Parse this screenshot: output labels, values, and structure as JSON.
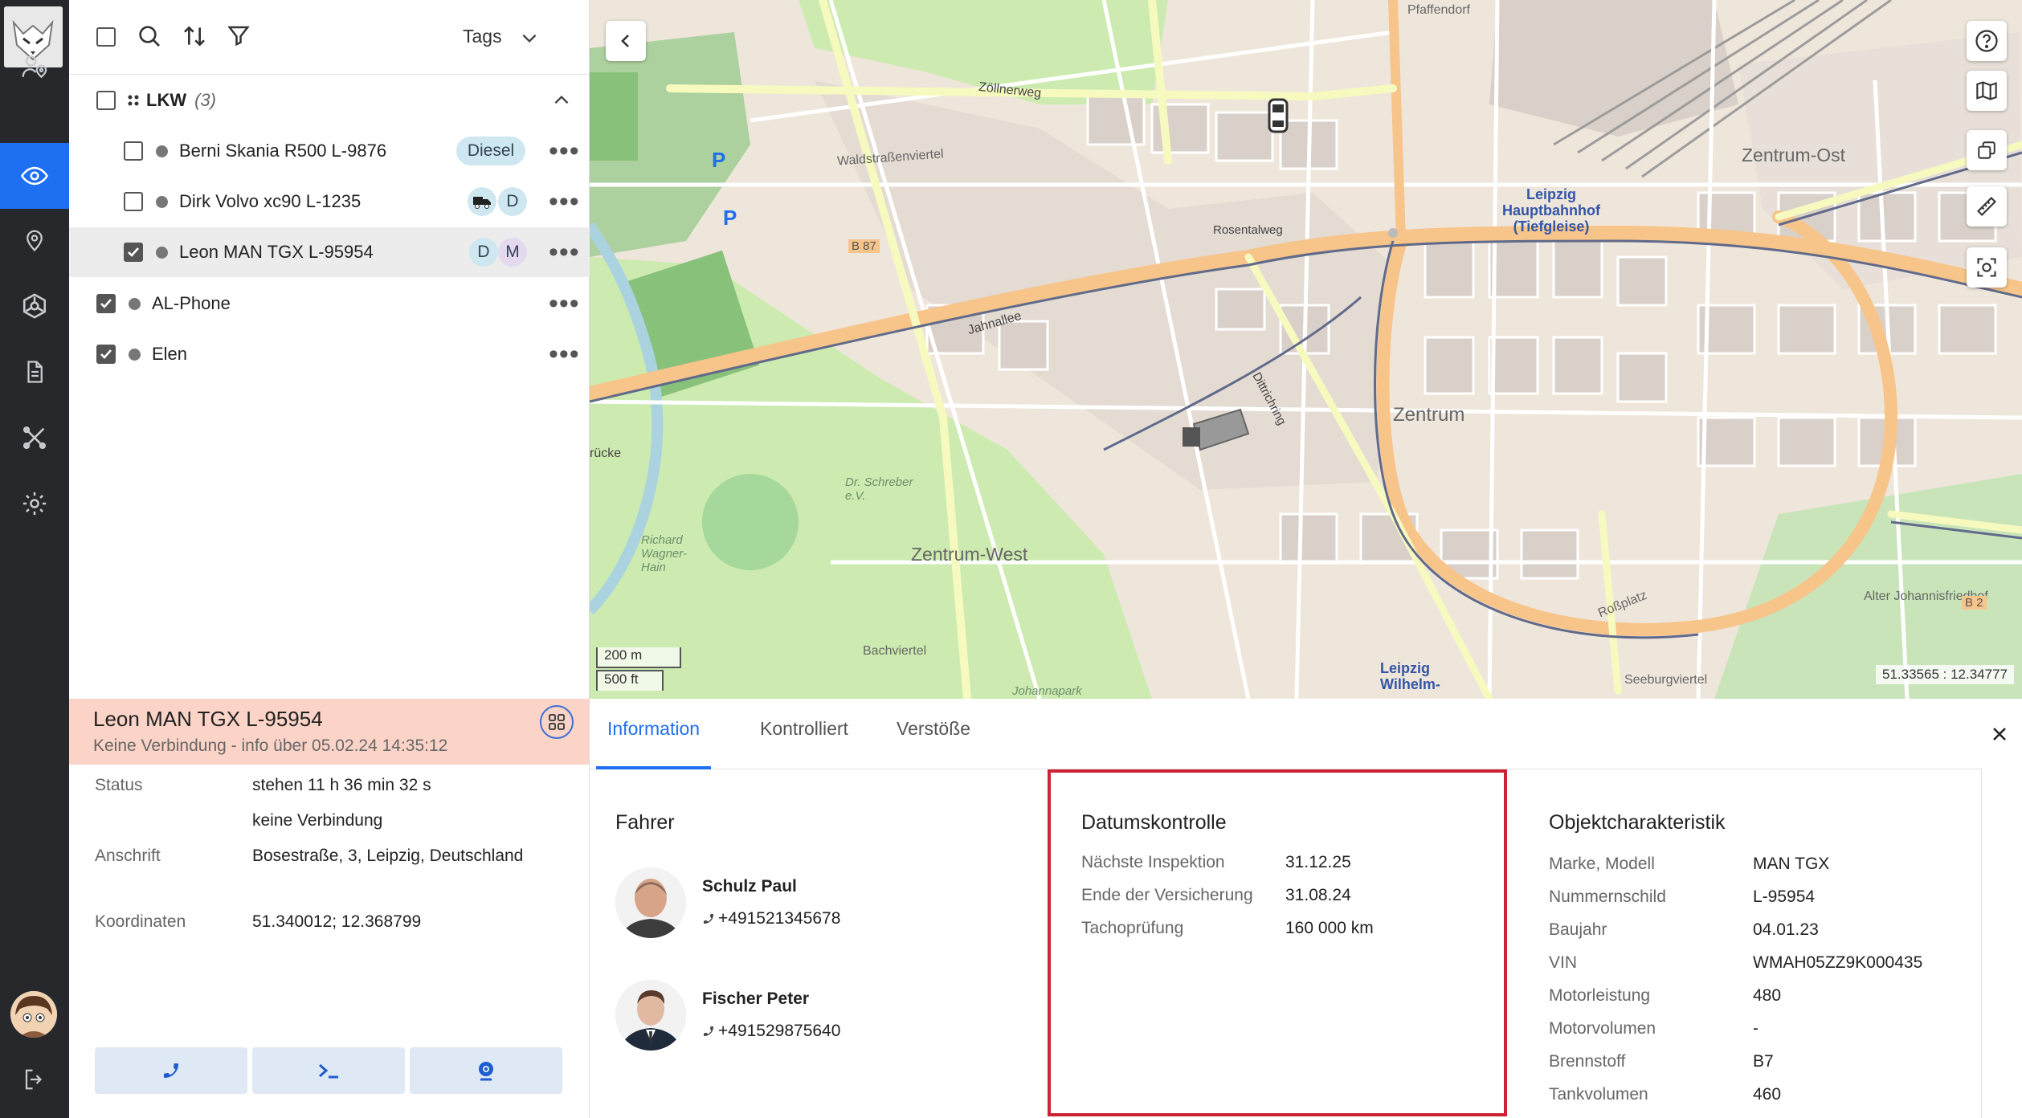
{
  "nav": {
    "items": [
      "users-location-icon",
      "eye-icon",
      "map-pin-icon",
      "geofence-icon",
      "document-icon",
      "tools-icon",
      "settings-icon"
    ],
    "logout": "logout-icon"
  },
  "list_toolbar": {
    "tags_label": "Tags"
  },
  "group": {
    "name": "LKW",
    "count": "(3)"
  },
  "vehicles": [
    {
      "name": "Berni Skania R500 L-9876",
      "badges": [
        "Diesel"
      ],
      "checked": false
    },
    {
      "name": "Dirk Volvo xc90 L-1235",
      "badges": [
        "truck",
        "D"
      ],
      "checked": false
    },
    {
      "name": "Leon MAN TGX L-95954",
      "badges": [
        "D",
        "M"
      ],
      "checked": true
    }
  ],
  "standalone": [
    {
      "name": "AL-Phone",
      "checked": true
    },
    {
      "name": "Elen",
      "checked": true
    }
  ],
  "detail": {
    "title": "Leon MAN TGX L-95954",
    "subtitle": "Keine Verbindung - info über 05.02.24 14:35:12",
    "status_label": "Status",
    "status_value": "stehen 11 h 36 min 32 s",
    "status_value2": "keine Verbindung",
    "address_label": "Anschrift",
    "address_value": "Bosestraße, 3, Leipzig, Deutschland",
    "coords_label": "Koordinaten",
    "coords_value": "51.340012; 12.368799"
  },
  "map": {
    "scale_m": "200 m",
    "scale_ft": "500 ft",
    "coords": "51.33565 : 12.34777",
    "labels": {
      "zentrum": "Zentrum",
      "zentrum_ost": "Zentrum-Ost",
      "zentrum_west": "Zentrum-West",
      "hbf": "Leipzig\nHauptbahnhof\n(Tiefgleise)",
      "wilhelm": "Leipzig\nWilhelm-",
      "waldstrassenviertel": "Waldstraßenviertel",
      "bachviertel": "Bachviertel",
      "seeburgviertel": "Seeburgviertel",
      "b87": "B 87",
      "b2": "B 2",
      "zollnerweg": "Zöllnerweg",
      "jahnallee": "Jahnallee",
      "dittrichring": "Dittrichring",
      "roßplatz": "Roßplatz",
      "rosental": "Rosentalweg",
      "alter_friedhof": "Alter Johannisfriedhof",
      "pfaffendorf": "Pfaffendorf",
      "rucke": "rücke",
      "schreber": "Dr. Schreber\ne.V.",
      "richard": "Richard\nWagner-\nHain",
      "johannapark": "Johannapark"
    }
  },
  "tabs": [
    "Information",
    "Kontrolliert",
    "Verstöße"
  ],
  "drivers": {
    "title": "Fahrer",
    "list": [
      {
        "name": "Schulz Paul",
        "phone": "+491521345678"
      },
      {
        "name": "Fischer Peter",
        "phone": "+491529875640"
      }
    ]
  },
  "date_control": {
    "title": "Datumskontrolle",
    "rows": [
      {
        "label": "Nächste Inspektion",
        "value": "31.12.25"
      },
      {
        "label": "Ende der Versicherung",
        "value": "31.08.24"
      },
      {
        "label": "Tachoprüfung",
        "value": "160 000 km"
      }
    ]
  },
  "object": {
    "title": "Objektcharakteristik",
    "rows": [
      {
        "label": "Marke, Modell",
        "value": "MAN TGX"
      },
      {
        "label": "Nummernschild",
        "value": "L-95954"
      },
      {
        "label": "Baujahr",
        "value": "04.01.23"
      },
      {
        "label": "VIN",
        "value": "WMAH05ZZ9K000435"
      },
      {
        "label": "Motorleistung",
        "value": "480"
      },
      {
        "label": "Motorvolumen",
        "value": "-"
      },
      {
        "label": "Brennstoff",
        "value": "B7"
      },
      {
        "label": "Tankvolumen",
        "value": "460"
      }
    ]
  },
  "colors": {
    "accent": "#1e6ff2",
    "sidebar": "#26282c",
    "highlight": "#cc2233",
    "alert_bg": "#fbd3c7"
  }
}
